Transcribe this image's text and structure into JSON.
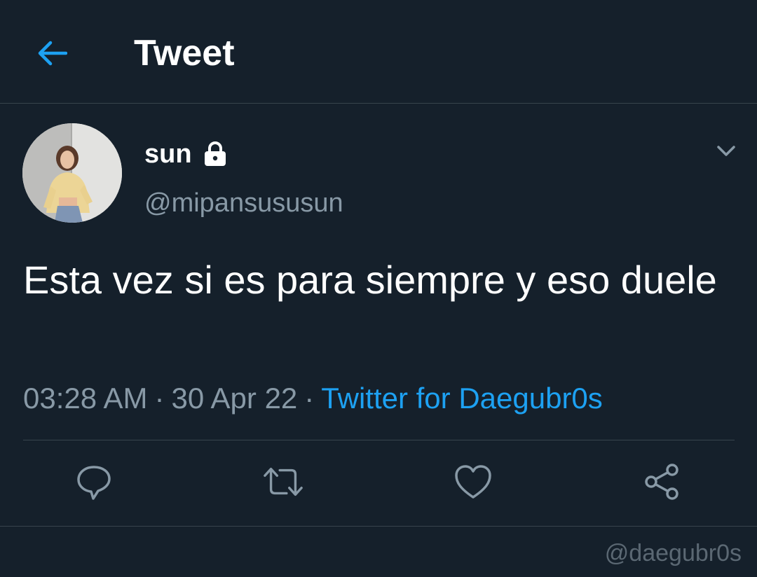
{
  "header": {
    "title": "Tweet",
    "back_icon": "arrow-left-icon",
    "accent_color": "#1da1f2"
  },
  "tweet": {
    "display_name": "sun",
    "protected_icon": "lock-icon",
    "handle": "@mipansususun",
    "text": "Esta vez si es para siempre y eso duele",
    "time": "03:28 AM",
    "separator": "·",
    "date": "30 Apr 22",
    "source": "Twitter for Daegubr0s",
    "menu_icon": "chevron-down-icon"
  },
  "actions": [
    {
      "name": "reply",
      "icon": "reply-icon"
    },
    {
      "name": "retweet",
      "icon": "retweet-icon"
    },
    {
      "name": "like",
      "icon": "heart-icon"
    },
    {
      "name": "share",
      "icon": "share-icon"
    }
  ],
  "watermark": "@daegubr0s",
  "colors": {
    "background": "#15202b",
    "border": "#38444d",
    "secondary_text": "#8899a6",
    "link": "#1da1f2"
  }
}
